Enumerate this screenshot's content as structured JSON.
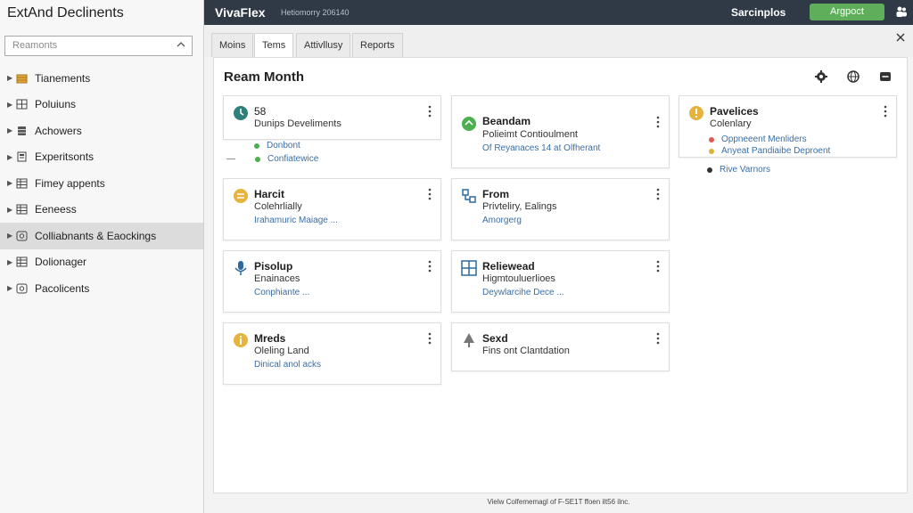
{
  "sidebar": {
    "title": "ExtAnd Declinents",
    "dropdown_value": "Reamonts",
    "items": [
      {
        "label": "Tianements",
        "icon": "folder-stack-icon",
        "color": "#d9a233"
      },
      {
        "label": "Poluiuns",
        "icon": "grid-icon",
        "color": "#4a4a4a"
      },
      {
        "label": "Achowers",
        "icon": "database-icon",
        "color": "#4a4a4a"
      },
      {
        "label": "Experitsonts",
        "icon": "document-icon",
        "color": "#4a4a4a"
      },
      {
        "label": "Fimey appents",
        "icon": "table-icon",
        "color": "#4a4a4a"
      },
      {
        "label": "Eeneess",
        "icon": "table-icon",
        "color": "#4a4a4a"
      },
      {
        "label": "Colliabnants & Eaockings",
        "icon": "gear-grid-icon",
        "color": "#4a4a4a",
        "selected": true
      },
      {
        "label": "Dolionager",
        "icon": "table-icon",
        "color": "#4a4a4a"
      },
      {
        "label": "Pacolicents",
        "icon": "gear-grid-icon",
        "color": "#4a4a4a"
      }
    ]
  },
  "topbar": {
    "brand": "VivaFlex",
    "subtitle": "Hetiomorry 206140",
    "link": "Sarcinplos",
    "approve": "Argpoct"
  },
  "tabs": [
    {
      "label": "Moins",
      "active": false
    },
    {
      "label": "Tems",
      "active": true
    },
    {
      "label": "Attivllusy",
      "active": false
    },
    {
      "label": "Reports",
      "active": false
    }
  ],
  "main": {
    "title": "Ream Month"
  },
  "cards": {
    "c1": {
      "title": "58",
      "sub": "Dunips Develiments",
      "link": ""
    },
    "c2": {
      "title": "Beandam",
      "sub": "Polieimt Contioulment",
      "link": "Of Reyanaces 14 at Olfherant"
    },
    "c3": {
      "title": "Pavelices",
      "sub": "Colenlary",
      "link": ""
    },
    "c4": {
      "title": "Harcit",
      "sub": "Colehrlially",
      "link": "Irahamuric Maiage ..."
    },
    "c5": {
      "title": "From",
      "sub": "Privteliry, Ealings",
      "link": "Amorgerg"
    },
    "c6": {
      "title": "Pisolup",
      "sub": "Enainaces",
      "link": "Conphiante ..."
    },
    "c7": {
      "title": "Reliewead",
      "sub": "Higmtouluerlioes",
      "link": "Deywlarcihe Dece ..."
    },
    "c8": {
      "title": "Mreds",
      "sub": "Oleling Land",
      "link": "Dinical anol acks"
    },
    "c9": {
      "title": "Sexd",
      "sub": "Fins ont Clantdation",
      "link": ""
    }
  },
  "extras": {
    "c1_line1": "Donbont",
    "c1_line2": "Confiatewice",
    "c1_dash": "—",
    "c3_line1": "Oppneeent Menliders",
    "c3_line2": "Anyeat Pandiaibe Deproent",
    "c3_below": "Rive Varnors"
  },
  "colors": {
    "green_dot": "#4caf50",
    "red_dot": "#e05a4f",
    "yellow_dot": "#e0b13a",
    "dark_dot": "#333333"
  },
  "footer": "Vielw Colfememagl of F-SE1T ffoen ilt56 ilnc."
}
